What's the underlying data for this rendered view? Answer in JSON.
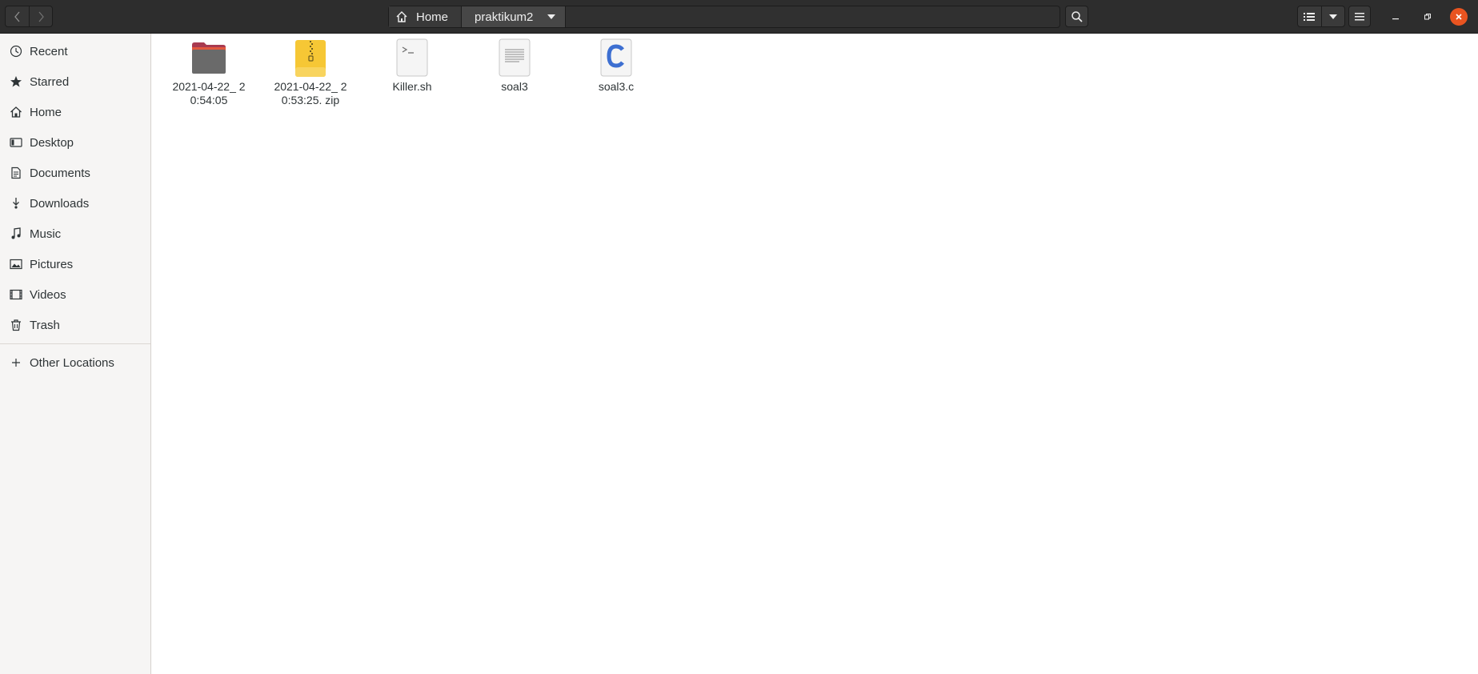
{
  "header": {
    "path": {
      "home_label": "Home",
      "current_label": "praktikum2"
    }
  },
  "sidebar": {
    "items": [
      {
        "label": "Recent",
        "icon": "clock-icon"
      },
      {
        "label": "Starred",
        "icon": "star-icon"
      },
      {
        "label": "Home",
        "icon": "home-icon"
      },
      {
        "label": "Desktop",
        "icon": "desktop-icon"
      },
      {
        "label": "Documents",
        "icon": "document-icon"
      },
      {
        "label": "Downloads",
        "icon": "download-icon"
      },
      {
        "label": "Music",
        "icon": "music-icon"
      },
      {
        "label": "Pictures",
        "icon": "picture-icon"
      },
      {
        "label": "Videos",
        "icon": "video-icon"
      },
      {
        "label": "Trash",
        "icon": "trash-icon"
      }
    ],
    "other_locations": {
      "label": "Other Locations",
      "icon": "plus-icon"
    }
  },
  "files": [
    {
      "name": "2021-04-22_ 20:54:05",
      "type": "folder",
      "icon": "folder-icon"
    },
    {
      "name": "2021-04-22_ 20:53:25. zip",
      "type": "zip",
      "icon": "zip-archive-icon"
    },
    {
      "name": "Killer.sh",
      "type": "script",
      "icon": "shell-script-icon"
    },
    {
      "name": "soal3",
      "type": "text",
      "icon": "text-file-icon"
    },
    {
      "name": "soal3.c",
      "type": "c-source",
      "icon": "c-source-icon"
    }
  ],
  "colors": {
    "headerbar": "#2d2d2d",
    "sidebar_bg": "#f6f5f4",
    "close_button": "#e95420",
    "zip_yellow": "#f4c430",
    "c_blue": "#3d6fd1"
  }
}
